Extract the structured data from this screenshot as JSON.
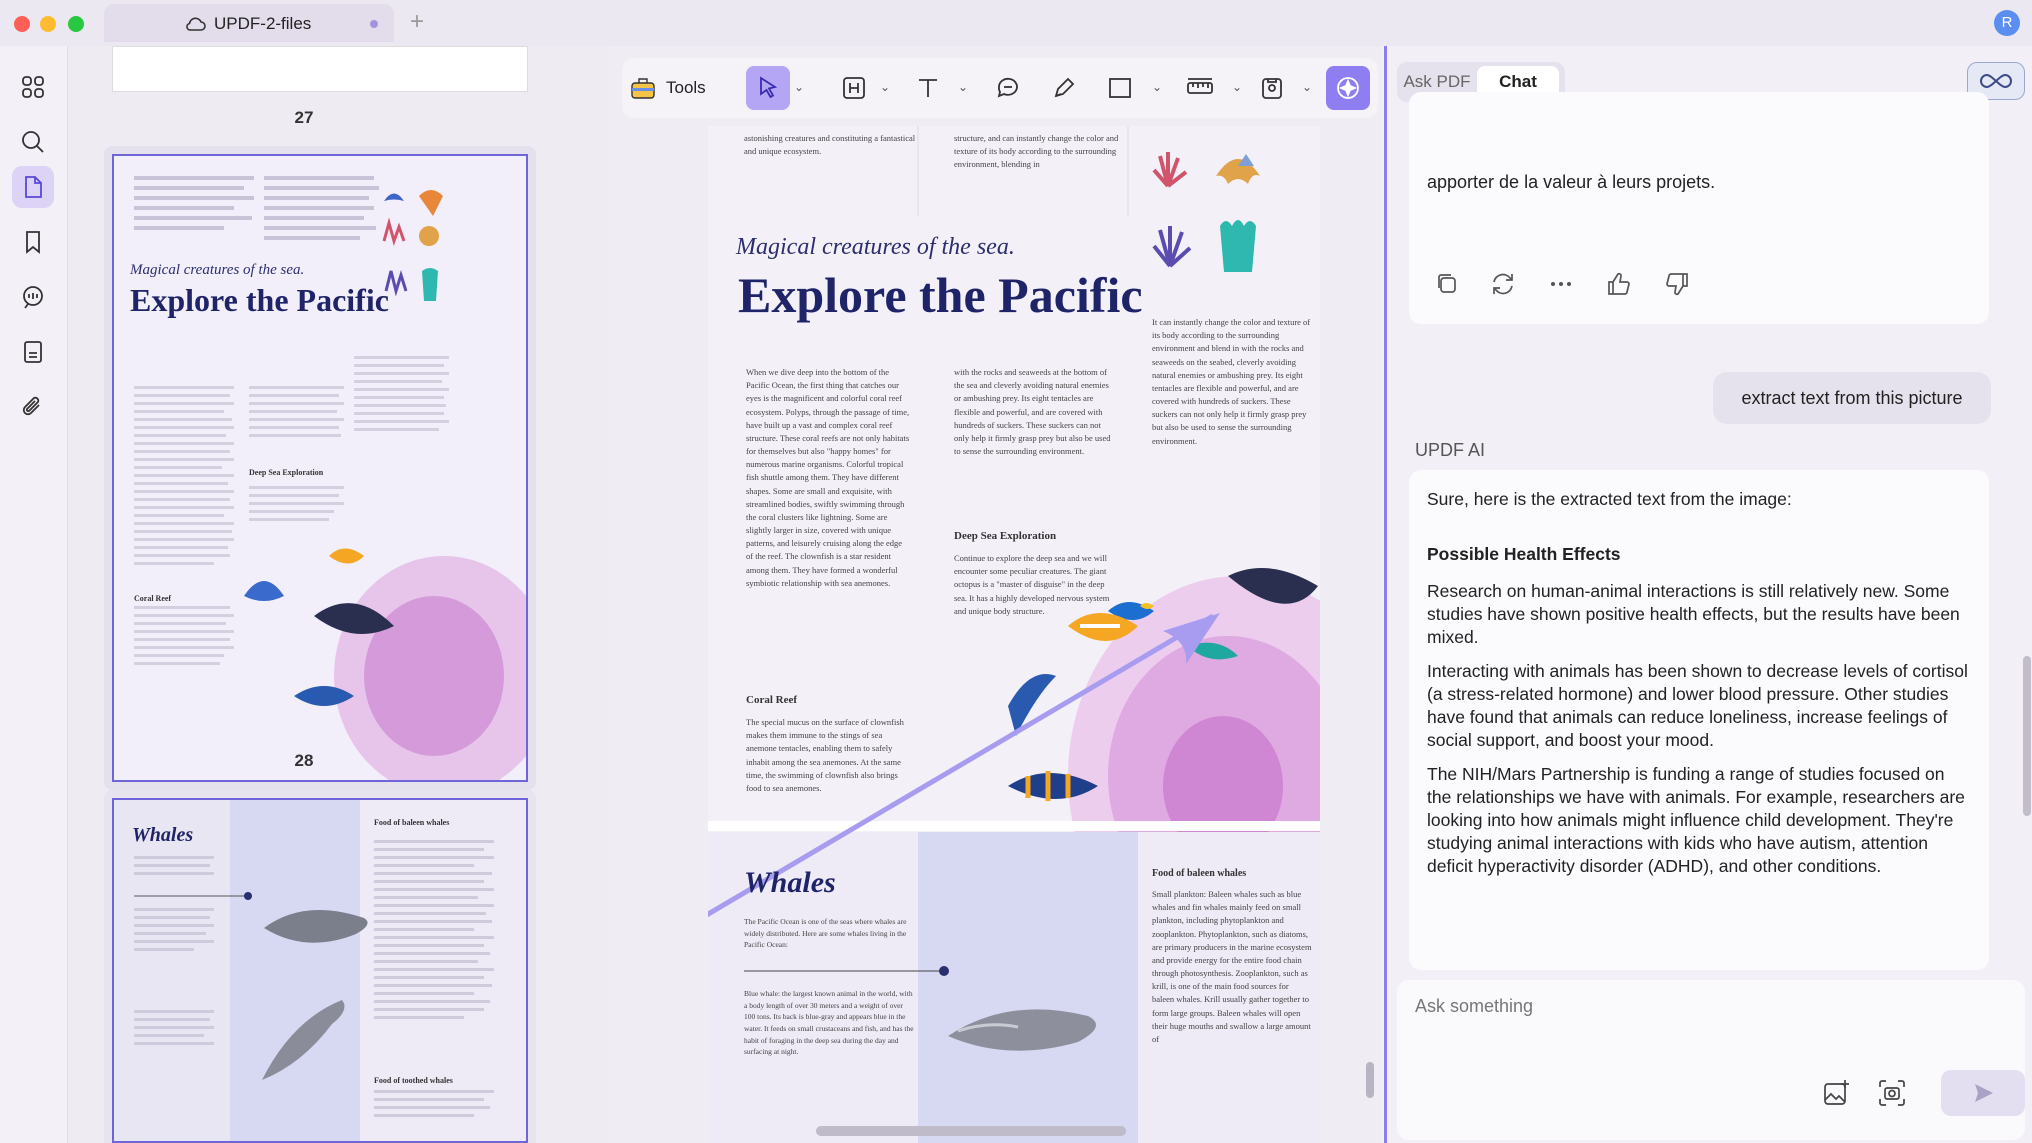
{
  "window": {
    "tab_title": "UPDF-2-files",
    "new_tab": "+",
    "avatar_initial": "R"
  },
  "sidebar": {
    "icons": [
      "apps-icon",
      "search-icon",
      "pages-icon",
      "bookmark-icon",
      "comment-icon",
      "document-icon",
      "attachment-icon"
    ],
    "active_index": 2
  },
  "thumbnails": {
    "pages": [
      {
        "number": "27"
      },
      {
        "number": "28"
      }
    ],
    "page28": {
      "subtitle": "Magical creatures of the sea.",
      "title": "Explore the Pacific",
      "headings": [
        "Deep Sea Exploration",
        "Coral Reef"
      ]
    },
    "page29": {
      "title": "Whales",
      "headings": [
        "Food of baleen whales",
        "Food of toothed whales"
      ]
    }
  },
  "toolbar": {
    "tools_label": "Tools"
  },
  "document": {
    "top_col1": "astonishing creatures and constituting a fantastical and unique ecosystem.",
    "top_col2": "structure, and can instantly change the color and texture of its body according to the surrounding environment, blending in",
    "subtitle": "Magical creatures of the sea.",
    "title": "Explore the Pacific",
    "col1": "When we dive deep into the bottom of the Pacific Ocean, the first thing that catches our eyes is the magnificent and colorful coral reef ecosystem. Polyps, through the passage of time, have built up a vast and complex coral reef structure. These coral reefs are not only habitats for themselves but also \"happy homes\" for numerous marine organisms. Colorful tropical fish shuttle among them. They have different shapes. Some are small and exquisite, with streamlined bodies, swiftly swimming through the coral clusters like lightning. Some are slightly larger in size, covered with unique patterns, and leisurely cruising along the edge of the reef. The clownfish is a star resident among them. They have formed a wonderful symbiotic relationship with sea anemones.",
    "col2": "with the rocks and seaweeds at the bottom of the sea and cleverly avoiding natural enemies or ambushing prey. Its eight tentacles are flexible and powerful, and are covered with hundreds of suckers. These suckers can not only help it firmly grasp prey but also be used to sense the surrounding environment.",
    "col3": "It can instantly change the color and texture of its body according to the surrounding environment and blend in with the rocks and seaweeds on the seabed, cleverly avoiding natural enemies or ambushing prey. Its eight tentacles are flexible and powerful, and are covered with hundreds of suckers. These suckers can not only help it firmly grasp prey but also be used to sense the surrounding environment.",
    "deep_sea_heading": "Deep Sea Exploration",
    "deep_sea_text": "Continue to explore the deep sea and we will encounter some peculiar creatures. The giant octopus is a \"master of disguise\" in the deep sea. It has a highly developed nervous system and unique body structure.",
    "coral_heading": "Coral Reef",
    "coral_text": "The special mucus on the surface of clownfish makes them immune to the stings of sea anemone tentacles, enabling them to safely inhabit among the sea anemones. At the same time, the swimming of clownfish also brings food to sea anemones.",
    "whales_title": "Whales",
    "whales_intro": "The Pacific Ocean is one of the seas where whales are widely distributed. Here are some whales living in the Pacific Ocean:",
    "blue_whale_text": "Blue whale: the largest known animal in the world, with a body length of over 30 meters and a weight of over 100 tons. Its back is blue-gray and appears blue in the water. It feeds on small crustaceans and fish, and has the habit of foraging in the deep sea during the day and surfacing at night.",
    "baleen_heading": "Food of baleen whales",
    "baleen_text": "Small plankton: Baleen whales such as blue whales and fin whales mainly feed on small plankton, including phytoplankton and zooplankton. Phytoplankton, such as diatoms, are primary producers in the marine ecosystem and provide energy for the entire food chain through photosynthesis. Zooplankton, such as krill, is one of the main food sources for baleen whales. Krill usually gather together to form large groups. Baleen whales will open their huge mouths and swallow a large amount of"
  },
  "ai_panel": {
    "tab_ask": "Ask PDF",
    "tab_chat": "Chat",
    "prev_message_tail": "apporter de la valeur à leurs projets.",
    "user_message": "extract text from this picture",
    "assistant_label": "UPDF AI",
    "answer_intro": "Sure, here is the extracted text from the image:",
    "answer_heading": "Possible Health Effects",
    "answer_p1": "Research on human-animal interactions is still relatively new. Some studies have shown positive health effects, but the results have been mixed.",
    "answer_p2": "Interacting with animals has been shown to decrease levels of cortisol (a stress-related hormone) and lower blood pressure. Other studies have found that animals can reduce loneliness, increase feelings of social support, and boost your mood.",
    "answer_p3": "The NIH/Mars Partnership is funding a range of studies focused on the relationships we have with animals. For example, researchers are looking into how animals might influence child development. They're studying animal interactions with kids who have autism, attention deficit hyperactivity disorder (ADHD), and other conditions.",
    "input_placeholder": "Ask something"
  },
  "colors": {
    "accent": "#8b7ef0",
    "active_tool": "#b4a6f5",
    "title_navy": "#1f2468"
  }
}
